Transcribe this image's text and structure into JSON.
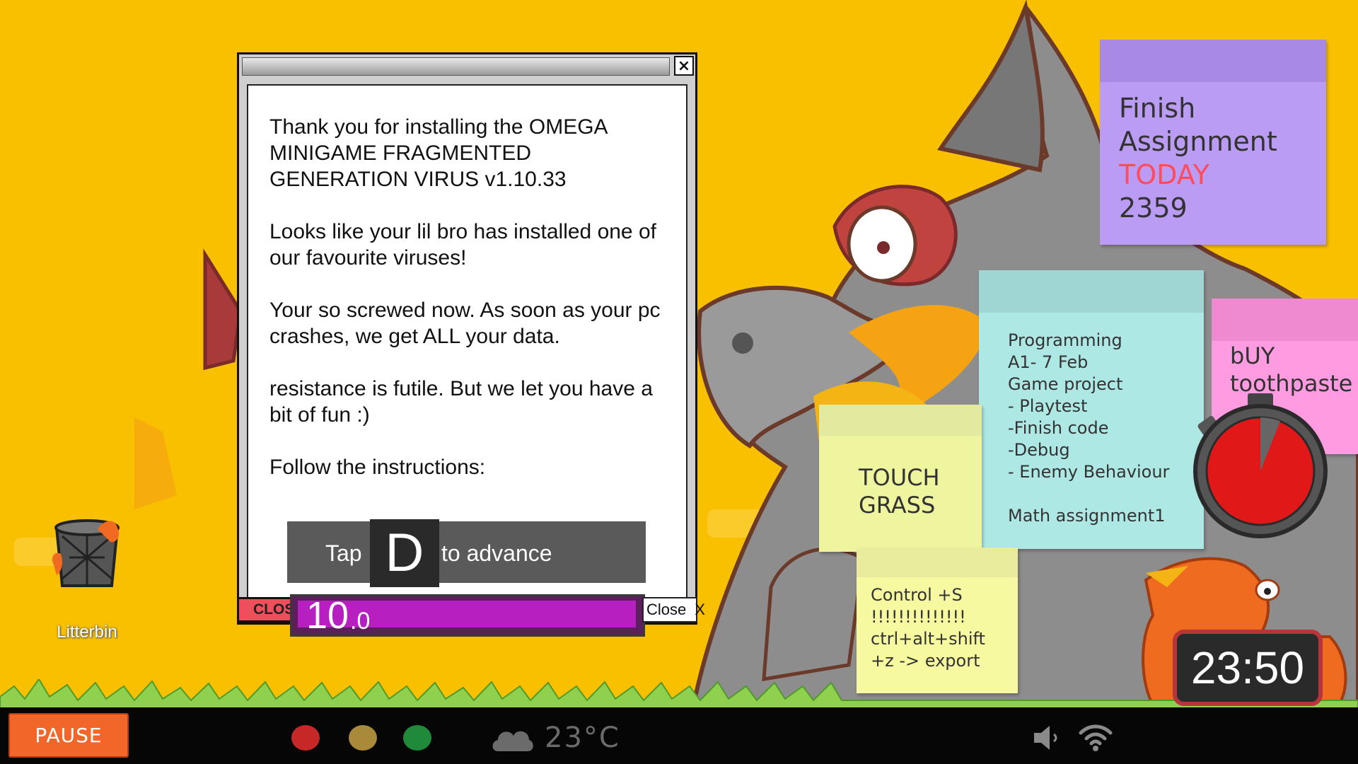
{
  "dialog": {
    "paragraphs": [
      "Thank you for installing the OMEGA MINIGAME FRAGMENTED GENERATION VIRUS v1.10.33",
      "Looks like your lil bro has installed one of our favourite viruses!",
      "Your so screwed now. As soon as your pc crashes, we get ALL your data.",
      "resistance is futile. But we let you have a bit of fun :)",
      "Follow the instructions:"
    ],
    "close_x": "×",
    "advance": {
      "tap": "Tap",
      "key": "D",
      "to_advance": "to advance"
    },
    "close_red_label": "CLOSE",
    "timer": {
      "whole": "10",
      "decimal": ".0",
      "remaining_fraction": 1.0
    },
    "close_white": {
      "label": "Close",
      "x": "X"
    }
  },
  "desktop": {
    "litterbin_label": "Litterbin"
  },
  "notes": {
    "purple": {
      "line1": "Finish",
      "line2": "Assignment",
      "line3": "TODAY",
      "line4": "2359"
    },
    "teal": {
      "text": "Programming\nA1- 7 Feb\nGame project\n- Playtest\n-Finish code\n-Debug\n- Enemy Behaviour\n\nMath assignment1"
    },
    "pink": {
      "line1": "bUY",
      "line2": "toothpaste"
    },
    "yellow1": {
      "line1": "TOUCH",
      "line2": "GRASS"
    },
    "yellow2": {
      "text": "Control +S\n!!!!!!!!!!!!!!\nctrl+alt+shift\n+z -> export"
    }
  },
  "stopwatch": {
    "elapsed_fraction": 0.06
  },
  "clock": {
    "time": "23:50"
  },
  "taskbar": {
    "pause_label": "PAUSE",
    "dots": [
      {
        "name": "red",
        "color": "#c62828"
      },
      {
        "name": "yellow",
        "color": "#a88a3a"
      },
      {
        "name": "green",
        "color": "#1f8a3a"
      }
    ],
    "weather": {
      "icon": "cloud-icon",
      "temp": "23°C"
    },
    "volume_icon": "volume-icon",
    "wifi_icon": "wifi-icon"
  },
  "colors": {
    "background": "#f9c000",
    "dialog_progress": "#b81fc0",
    "close_red": "#ee4f5b",
    "pause": "#f2662a"
  }
}
